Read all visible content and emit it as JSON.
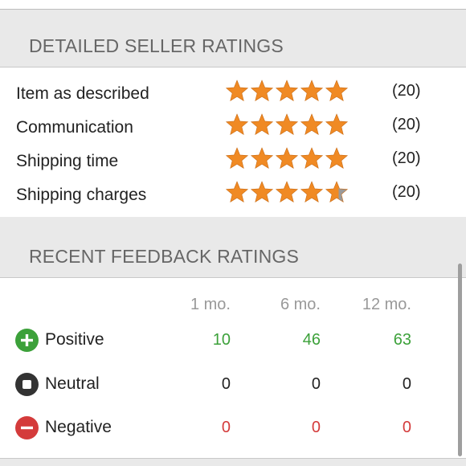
{
  "colors": {
    "star": "#f08a24",
    "star_empty": "#9a9a9a",
    "positive": "#3ca13a",
    "neutral": "#222222",
    "negative": "#d43b3b"
  },
  "detailed_ratings": {
    "title": "DETAILED SELLER RATINGS",
    "rows": [
      {
        "label": "Item as described",
        "stars": 5,
        "count": "(20)"
      },
      {
        "label": "Communication",
        "stars": 5,
        "count": "(20)"
      },
      {
        "label": "Shipping time",
        "stars": 5,
        "count": "(20)"
      },
      {
        "label": "Shipping charges",
        "stars": 4.6,
        "count": "(20)"
      }
    ]
  },
  "feedback": {
    "title": "RECENT FEEDBACK RATINGS",
    "columns": [
      "1 mo.",
      "6 mo.",
      "12 mo."
    ],
    "rows": [
      {
        "label": "Positive",
        "icon": "plus-circle-icon",
        "values": [
          "10",
          "46",
          "63"
        ]
      },
      {
        "label": "Neutral",
        "icon": "square-circle-icon",
        "values": [
          "0",
          "0",
          "0"
        ]
      },
      {
        "label": "Negative",
        "icon": "minus-circle-icon",
        "values": [
          "0",
          "0",
          "0"
        ]
      }
    ]
  }
}
